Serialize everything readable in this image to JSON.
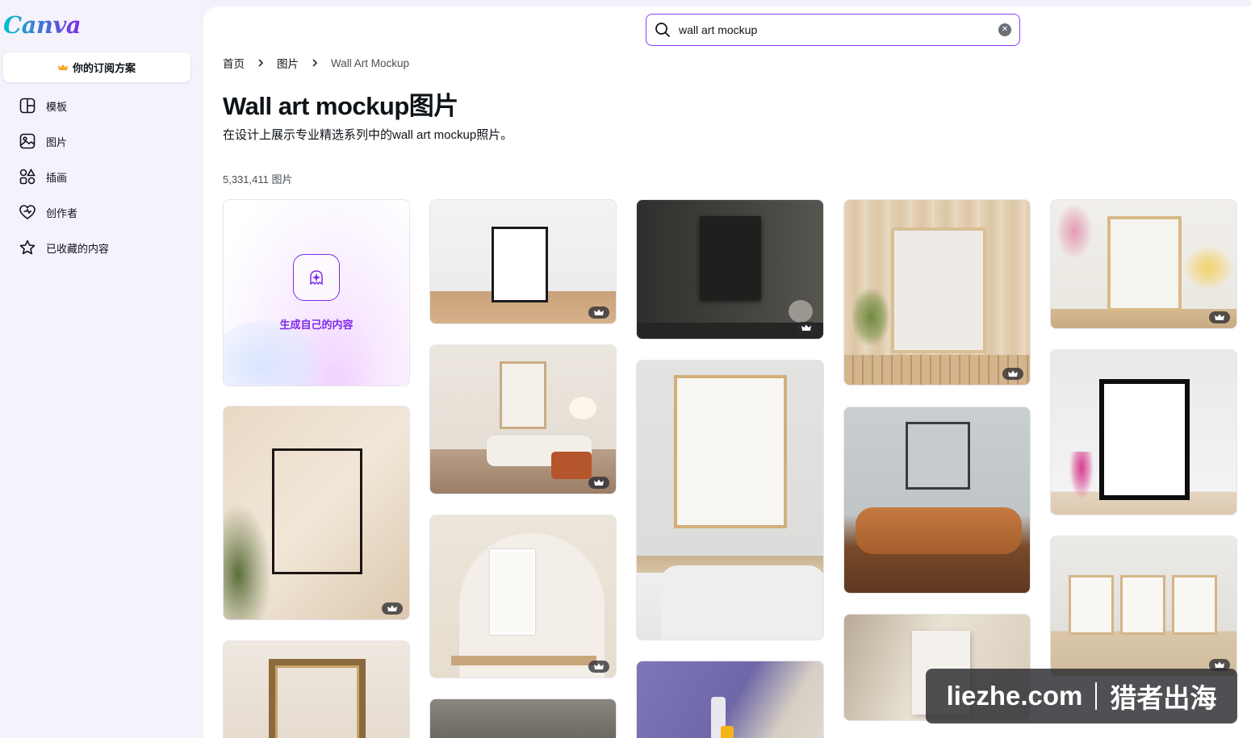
{
  "app": {
    "logo": "Canva"
  },
  "sidebar": {
    "plan_button": "你的订阅方案",
    "items": [
      {
        "label": "模板",
        "icon": "template-icon"
      },
      {
        "label": "图片",
        "icon": "image-icon"
      },
      {
        "label": "插画",
        "icon": "shapes-icon"
      },
      {
        "label": "创作者",
        "icon": "heart-icon"
      },
      {
        "label": "已收藏的内容",
        "icon": "star-icon"
      }
    ]
  },
  "search": {
    "value": "wall art mockup"
  },
  "breadcrumb": {
    "home": "首页",
    "section": "图片",
    "current": "Wall Art Mockup"
  },
  "page": {
    "title": "Wall art mockup图片",
    "subtitle": "在设计上展示专业精选系列中的wall art mockup照片。",
    "count": "5,331,411 图片"
  },
  "generate_tile": {
    "label": "生成自己的内容"
  },
  "colors": {
    "accent": "#7d2ae8",
    "search_border": "#8b3dff"
  },
  "watermark": {
    "left": "liezhe.com",
    "right": "猎者出海"
  }
}
